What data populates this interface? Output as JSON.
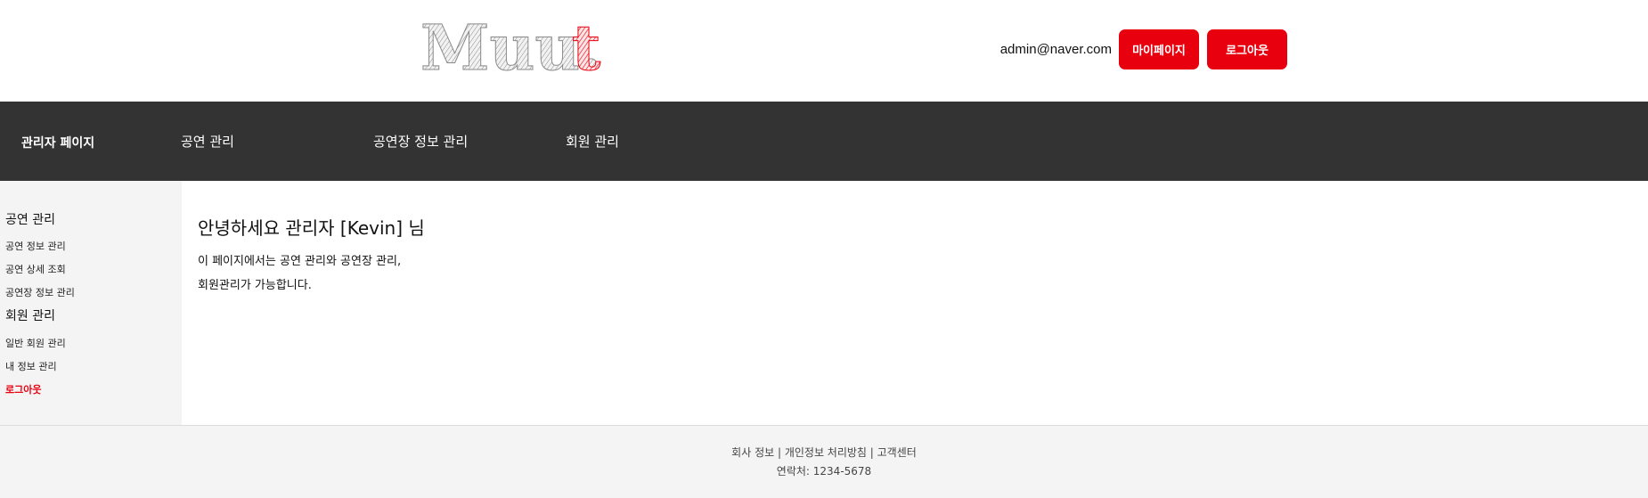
{
  "header": {
    "logo_text_main": "Muu.",
    "logo_text_accent": "t",
    "user_email": "admin@naver.com",
    "mypage_label": "마이페이지",
    "logout_label": "로그아웃"
  },
  "nav": {
    "brand": "관리자 페이지",
    "items": [
      {
        "label": "공연 관리"
      },
      {
        "label": "공연장 정보 관리"
      },
      {
        "label": "회원 관리"
      }
    ]
  },
  "sidebar": {
    "section1": {
      "heading": "공연 관리",
      "links": [
        "공연 정보 관리",
        "공연 상세 조회",
        "공연장 정보 관리"
      ]
    },
    "section2": {
      "heading": "회원 관리",
      "links": [
        "일반 회원 관리",
        "내 정보 관리",
        "로그아웃"
      ]
    }
  },
  "main": {
    "title": "안녕하세요 관리자 [Kevin] 님",
    "desc_line1": "이 페이지에서는 공연 관리와 공연장 관리,",
    "desc_line2": "회원관리가 가능합니다."
  },
  "footer": {
    "links": [
      "회사 정보",
      "개인정보 처리방침",
      "고객센터"
    ],
    "separator": " | ",
    "contact": "연락처: 1234-5678"
  },
  "colors": {
    "accent": "#e8000f",
    "nav_bg": "#333333",
    "sidebar_bg": "#f4f4f4",
    "footer_bg": "#f4f4f4"
  }
}
